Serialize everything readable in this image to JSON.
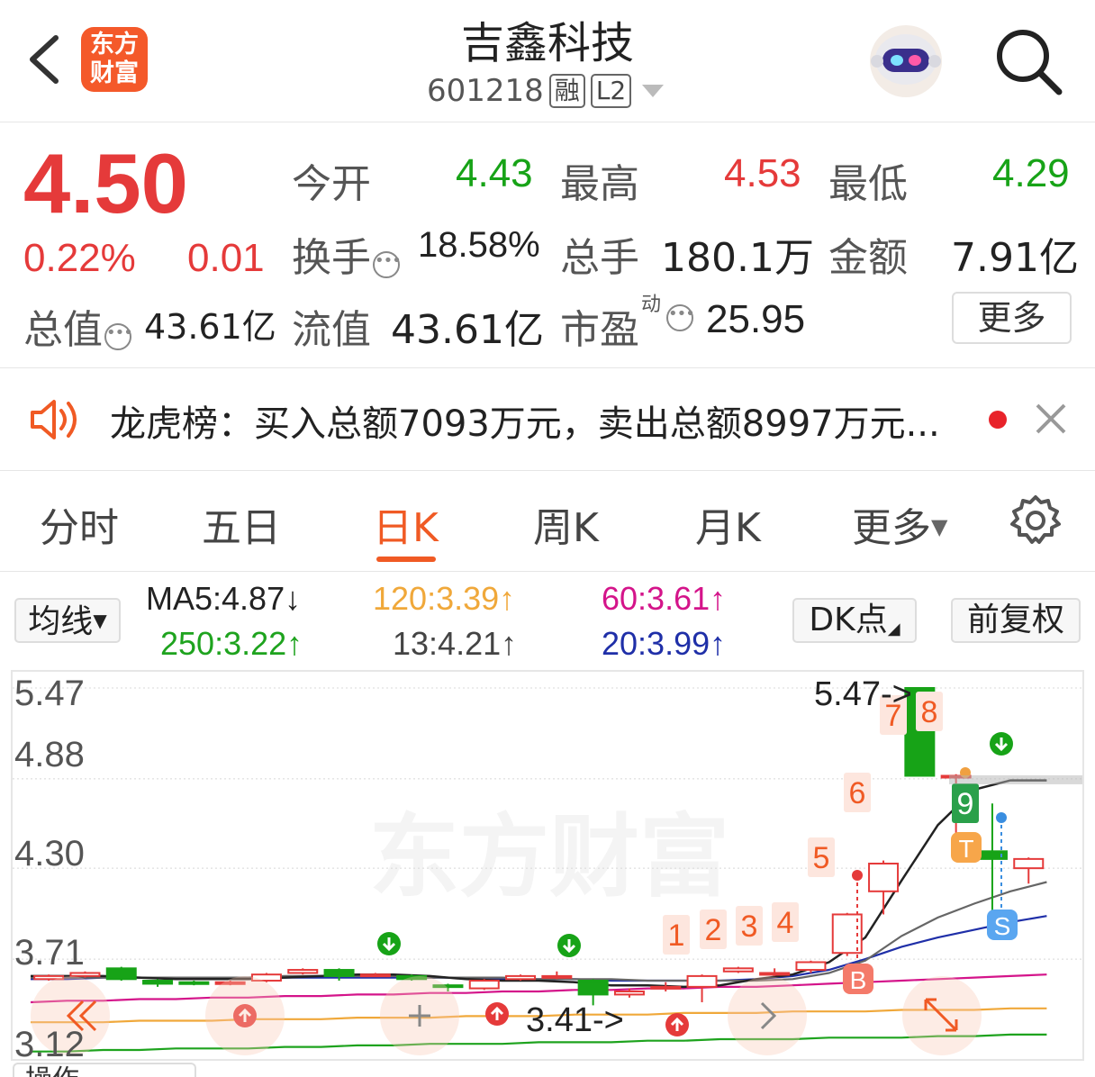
{
  "header": {
    "title": "吉鑫科技",
    "code": "601218",
    "tag_rong": "融",
    "tag_level": "L2",
    "logo_line1": "东方",
    "logo_line2": "财富"
  },
  "quote": {
    "price": "4.50",
    "change_pct": "0.22%",
    "change_amt": "0.01",
    "open_label": "今开",
    "open": "4.43",
    "high_label": "最高",
    "high": "4.53",
    "low_label": "最低",
    "low": "4.29",
    "turnover_label": "换手",
    "turnover": "18.58%",
    "volume_label": "总手",
    "volume": "180.1万",
    "amount_label": "金额",
    "amount": "7.91亿",
    "mktcap_label": "总值",
    "mktcap": "43.61亿",
    "float_label": "流值",
    "float_cap": "43.61亿",
    "pe_label": "市盈",
    "pe_sup": "动",
    "pe": "25.95",
    "more": "更多"
  },
  "news": {
    "text": "龙虎榜：买入总额7093万元，卖出总额8997万元..."
  },
  "tabs": [
    "分时",
    "五日",
    "日K",
    "周K",
    "月K",
    "更多"
  ],
  "active_tab": "日K",
  "legend": {
    "junxian": "均线",
    "ma5": "MA5:4.87↓",
    "ma120": "120:3.39↑",
    "ma60": "60:3.61↑",
    "ma250": "250:3.22↑",
    "ma13": "13:4.21↑",
    "ma20": "20:3.99↑",
    "dk": "DK点",
    "fq": "前复权"
  },
  "colors": {
    "up": "#e53a3a",
    "down": "#17a317",
    "accent": "#f05a24",
    "ma5": "#222222",
    "ma13": "#666666",
    "ma20": "#1f2fa8",
    "ma60": "#d4148a",
    "ma120": "#f0a83a",
    "ma250": "#1ea31e"
  },
  "chart": {
    "y_labels": [
      "5.47",
      "4.88",
      "4.30",
      "3.71",
      "3.12"
    ],
    "watermark": "东方财富",
    "high_annot": "5.47->",
    "low_annot": "3.41->",
    "markers": [
      "1",
      "2",
      "3",
      "4",
      "5",
      "6",
      "7",
      "8",
      "9"
    ],
    "buy_marker": "B",
    "sell_marker": "S",
    "t_marker": "T"
  },
  "bottom_tab": "操作",
  "chart_data": {
    "type": "candlestick",
    "ylim": [
      3.12,
      5.47
    ],
    "candles": [
      {
        "o": 3.58,
        "c": 3.6,
        "h": 3.61,
        "l": 3.57
      },
      {
        "o": 3.6,
        "c": 3.62,
        "h": 3.63,
        "l": 3.59
      },
      {
        "o": 3.65,
        "c": 3.58,
        "h": 3.66,
        "l": 3.57
      },
      {
        "o": 3.57,
        "c": 3.55,
        "h": 3.58,
        "l": 3.53
      },
      {
        "o": 3.56,
        "c": 3.55,
        "h": 3.57,
        "l": 3.54
      },
      {
        "o": 3.55,
        "c": 3.56,
        "h": 3.57,
        "l": 3.54
      },
      {
        "o": 3.57,
        "c": 3.61,
        "h": 3.62,
        "l": 3.56
      },
      {
        "o": 3.62,
        "c": 3.64,
        "h": 3.65,
        "l": 3.61
      },
      {
        "o": 3.64,
        "c": 3.6,
        "h": 3.65,
        "l": 3.57
      },
      {
        "o": 3.61,
        "c": 3.61,
        "h": 3.62,
        "l": 3.6
      },
      {
        "o": 3.6,
        "c": 3.58,
        "h": 3.61,
        "l": 3.57
      },
      {
        "o": 3.54,
        "c": 3.53,
        "h": 3.55,
        "l": 3.5
      },
      {
        "o": 3.52,
        "c": 3.57,
        "h": 3.58,
        "l": 3.51
      },
      {
        "o": 3.58,
        "c": 3.6,
        "h": 3.61,
        "l": 3.57
      },
      {
        "o": 3.6,
        "c": 3.6,
        "h": 3.63,
        "l": 3.58
      },
      {
        "o": 3.57,
        "c": 3.48,
        "h": 3.58,
        "l": 3.41
      },
      {
        "o": 3.48,
        "c": 3.5,
        "h": 3.52,
        "l": 3.46
      },
      {
        "o": 3.53,
        "c": 3.53,
        "h": 3.56,
        "l": 3.5
      },
      {
        "o": 3.53,
        "c": 3.6,
        "h": 3.61,
        "l": 3.43
      },
      {
        "o": 3.63,
        "c": 3.65,
        "h": 3.66,
        "l": 3.62
      },
      {
        "o": 3.62,
        "c": 3.62,
        "h": 3.65,
        "l": 3.6
      },
      {
        "o": 3.64,
        "c": 3.69,
        "h": 3.7,
        "l": 3.62
      },
      {
        "o": 3.75,
        "c": 4.0,
        "h": 4.01,
        "l": 3.73
      },
      {
        "o": 4.15,
        "c": 4.33,
        "h": 4.35,
        "l": 4.0
      },
      {
        "o": 5.47,
        "c": 4.9,
        "h": 5.47,
        "l": 4.9
      },
      {
        "o": 4.9,
        "c": 4.9,
        "h": 4.91,
        "l": 4.4
      },
      {
        "o": 4.41,
        "c": 4.36,
        "h": 4.72,
        "l": 4.0
      },
      {
        "o": 4.3,
        "c": 4.36,
        "h": 4.37,
        "l": 4.2
      }
    ],
    "ma5": [
      3.6,
      3.6,
      3.6,
      3.59,
      3.58,
      3.58,
      3.58,
      3.59,
      3.6,
      3.61,
      3.61,
      3.6,
      3.58,
      3.57,
      3.57,
      3.56,
      3.54,
      3.54,
      3.53,
      3.54,
      3.58,
      3.61,
      3.69,
      3.85,
      4.22,
      4.58,
      4.81,
      4.87,
      4.87
    ],
    "ma13": [
      3.59,
      3.59,
      3.59,
      3.59,
      3.59,
      3.59,
      3.59,
      3.6,
      3.6,
      3.6,
      3.6,
      3.59,
      3.59,
      3.59,
      3.58,
      3.58,
      3.58,
      3.57,
      3.57,
      3.57,
      3.57,
      3.58,
      3.62,
      3.7,
      3.86,
      3.98,
      4.07,
      4.15,
      4.21
    ],
    "ma20": [
      3.58,
      3.58,
      3.59,
      3.59,
      3.59,
      3.59,
      3.59,
      3.59,
      3.59,
      3.59,
      3.59,
      3.59,
      3.59,
      3.58,
      3.58,
      3.58,
      3.57,
      3.57,
      3.57,
      3.57,
      3.58,
      3.6,
      3.64,
      3.71,
      3.79,
      3.85,
      3.9,
      3.95,
      3.99
    ],
    "ma60": [
      3.43,
      3.44,
      3.44,
      3.45,
      3.45,
      3.46,
      3.46,
      3.47,
      3.47,
      3.48,
      3.48,
      3.49,
      3.49,
      3.5,
      3.5,
      3.51,
      3.51,
      3.52,
      3.52,
      3.53,
      3.53,
      3.54,
      3.55,
      3.56,
      3.57,
      3.58,
      3.59,
      3.6,
      3.61
    ],
    "ma120": [
      3.3,
      3.3,
      3.3,
      3.31,
      3.31,
      3.31,
      3.32,
      3.32,
      3.32,
      3.33,
      3.33,
      3.33,
      3.34,
      3.34,
      3.34,
      3.35,
      3.35,
      3.35,
      3.36,
      3.36,
      3.36,
      3.37,
      3.37,
      3.37,
      3.38,
      3.38,
      3.38,
      3.39,
      3.39
    ],
    "ma250": [
      3.11,
      3.11,
      3.12,
      3.12,
      3.13,
      3.13,
      3.13,
      3.14,
      3.14,
      3.15,
      3.15,
      3.16,
      3.16,
      3.16,
      3.17,
      3.17,
      3.17,
      3.18,
      3.18,
      3.19,
      3.19,
      3.19,
      3.2,
      3.2,
      3.2,
      3.21,
      3.21,
      3.22,
      3.22
    ]
  }
}
